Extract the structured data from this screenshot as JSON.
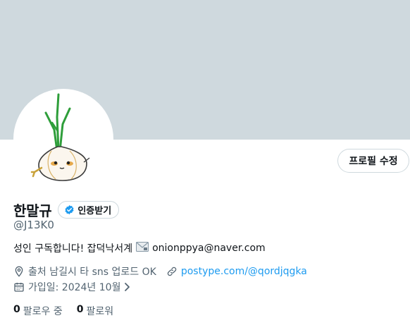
{
  "profile": {
    "edit_label": "프로필 수정",
    "display_name": "한말규",
    "verify_label": "인증받기",
    "handle": "@J13K0",
    "bio_text": "성인 구독합니다! 잡덕낙서계",
    "bio_email": "onionppya@naver.com",
    "location": "출처 남길시 타 sns 업로드 OK",
    "website": "postype.com/@qordjqgka",
    "joined": "가입일: 2024년 10월",
    "following_count": "0",
    "following_label": "팔로우 중",
    "followers_count": "0",
    "followers_label": "팔로워"
  },
  "colors": {
    "banner": "#cfd9de",
    "accent": "#1d9bf0",
    "secondary_text": "#536471"
  },
  "icons": [
    "onion-avatar",
    "verified-badge-icon",
    "envelope-icon",
    "location-pin-icon",
    "link-icon",
    "calendar-icon",
    "chevron-right-icon"
  ]
}
